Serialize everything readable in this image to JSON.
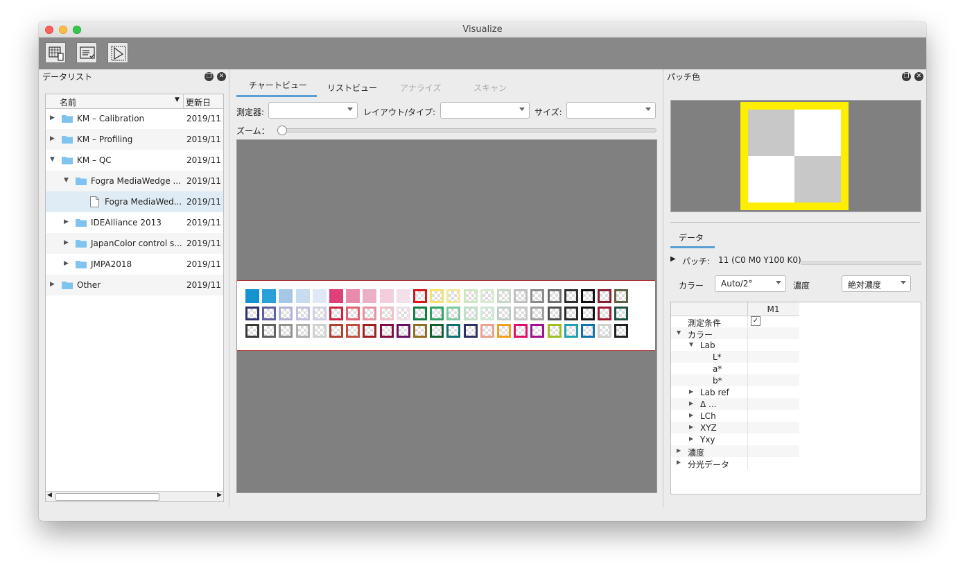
{
  "window": {
    "title": "Visualize"
  },
  "left_panel": {
    "title": "データリスト",
    "columns": {
      "name": "名前",
      "date": "更新日"
    },
    "rows": [
      {
        "label": "KM – Calibration",
        "date": "2019/11",
        "level": 0,
        "expanded": false,
        "kind": "folder"
      },
      {
        "label": "KM – Profiling",
        "date": "2019/11",
        "level": 0,
        "expanded": false,
        "kind": "folder"
      },
      {
        "label": "KM – QC",
        "date": "2019/11",
        "level": 0,
        "expanded": true,
        "kind": "folder"
      },
      {
        "label": "Fogra MediaWedge ...",
        "date": "2019/11",
        "level": 1,
        "expanded": true,
        "kind": "folder"
      },
      {
        "label": "Fogra MediaWed...",
        "date": "2019/11",
        "level": 2,
        "expanded": false,
        "kind": "file",
        "selected": true
      },
      {
        "label": "IDEAlliance 2013",
        "date": "2019/11",
        "level": 1,
        "expanded": false,
        "kind": "folder"
      },
      {
        "label": "JapanColor control s...",
        "date": "2019/11",
        "level": 1,
        "expanded": false,
        "kind": "folder"
      },
      {
        "label": "JMPA2018",
        "date": "2019/11",
        "level": 1,
        "expanded": false,
        "kind": "folder"
      },
      {
        "label": "Other",
        "date": "2019/11",
        "level": 0,
        "expanded": false,
        "kind": "folder"
      }
    ]
  },
  "center": {
    "tabs": [
      {
        "label": "チャートビュー",
        "state": "active"
      },
      {
        "label": "リストビュー",
        "state": "normal"
      },
      {
        "label": "アナライズ",
        "state": "disabled"
      },
      {
        "label": "スキャン",
        "state": "disabled"
      }
    ],
    "device_label": "測定器:",
    "layout_label": "レイアウト/タイプ:",
    "size_label": "サイズ:",
    "zoom_label": "ズーム：",
    "device_value": "",
    "layout_value": "",
    "size_value": ""
  },
  "right_panel": {
    "title": "パッチ色",
    "data_tab": "データ",
    "patch_label": "パッチ:",
    "patch_value": "11 (C0 M0 Y100 K0)",
    "color_label": "カラー",
    "color_value": "Auto/2°",
    "density_label": "濃度",
    "density_value": "絶対濃度",
    "column_header": "M1",
    "rows": [
      {
        "label": "測定条件",
        "indent": 0,
        "toggle": "none",
        "checked": true
      },
      {
        "label": "カラー",
        "indent": 0,
        "toggle": "open"
      },
      {
        "label": "Lab",
        "indent": 1,
        "toggle": "open"
      },
      {
        "label": "L*",
        "indent": 2,
        "toggle": "none"
      },
      {
        "label": "a*",
        "indent": 2,
        "toggle": "none"
      },
      {
        "label": "b*",
        "indent": 2,
        "toggle": "none"
      },
      {
        "label": "Lab ref",
        "indent": 1,
        "toggle": "closed"
      },
      {
        "label": "Δ ...",
        "indent": 1,
        "toggle": "closed"
      },
      {
        "label": "LCh",
        "indent": 1,
        "toggle": "closed"
      },
      {
        "label": "XYZ",
        "indent": 1,
        "toggle": "closed"
      },
      {
        "label": "Yxy",
        "indent": 1,
        "toggle": "closed"
      },
      {
        "label": "濃度",
        "indent": 0,
        "toggle": "closed"
      },
      {
        "label": "分光データ",
        "indent": 0,
        "toggle": "closed"
      }
    ]
  },
  "colors": {
    "accent": "#5a9fd4",
    "patch_frame": "#ffee00",
    "patch_light": "#c8c8c8",
    "patch_white": "#ffffff",
    "folder": "#7ec4ef",
    "selected_row": "#dfecf5"
  },
  "chart_patches": {
    "row1": [
      "#1591d0",
      "#2aa0d8",
      "#a6c8e8",
      "#c8dcf0",
      "#dfe8f6",
      "#e0407a",
      "#e88aac",
      "#ecb0c6",
      "#f2cedc",
      "#f4e0ea",
      "#d81818",
      "#f5e070",
      "#f2e8a0",
      "#cfe8c0",
      "#d8ecd0",
      "#c8d8c8",
      "#c0c0c0",
      "#8c8c8c",
      "#707070",
      "#303030",
      "#101010",
      "#882030",
      "#606040"
    ],
    "row2": [
      "#303070",
      "#6060a0",
      "#b0b0d8",
      "#c0c0e0",
      "#d0d0e0",
      "#d02040",
      "#e06070",
      "#e890a0",
      "#f0c0c8",
      "#f0e0e8",
      "#108040",
      "#30a060",
      "#80c8a0",
      "#c0e0c8",
      "#d0e8d8",
      "#c0d0c8",
      "#c8c8c8",
      "#a0a0a0",
      "#505050",
      "#282828",
      "#101010",
      "#a01830",
      "#205040"
    ],
    "row3": [
      "#383838",
      "#606060",
      "#909090",
      "#b0b0b0",
      "#d0d0d0",
      "#b04030",
      "#c05040",
      "#a02020",
      "#801040",
      "#6a1060",
      "#907020",
      "#106030",
      "#107070",
      "#303060",
      "#f0a090",
      "#f0a020",
      "#e0106a",
      "#a01090",
      "#a0c020",
      "#20a0b0",
      "#1070b0",
      "#d0d0d0",
      "#202020",
      "#a04050",
      "#104040"
    ]
  }
}
